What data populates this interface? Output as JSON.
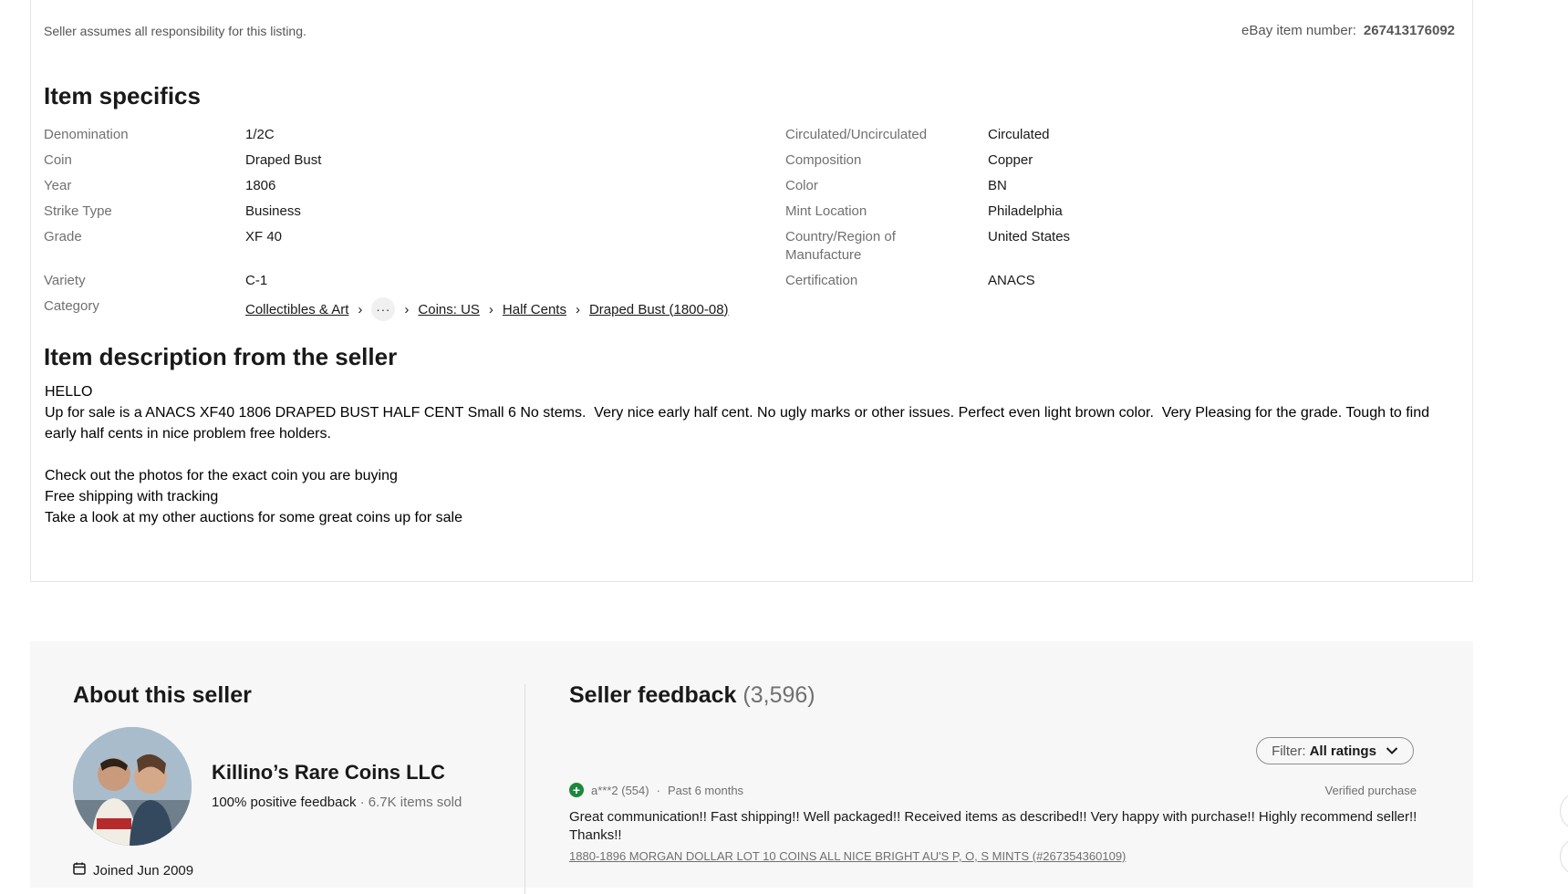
{
  "listing": {
    "disclaimer": "Seller assumes all responsibility for this listing.",
    "item_number_label": "eBay item number:",
    "item_number": "267413176092"
  },
  "specifics": {
    "title": "Item specifics",
    "left": [
      {
        "label": "Denomination",
        "value": "1/2C"
      },
      {
        "label": "Coin",
        "value": "Draped Bust"
      },
      {
        "label": "Year",
        "value": "1806"
      },
      {
        "label": "Strike Type",
        "value": "Business"
      },
      {
        "label": "Grade",
        "value": "XF 40"
      },
      {
        "label": "Variety",
        "value": "C-1"
      },
      {
        "label": "Category",
        "value": ""
      }
    ],
    "right": [
      {
        "label": "Circulated/Uncirculated",
        "value": "Circulated"
      },
      {
        "label": "Composition",
        "value": "Copper"
      },
      {
        "label": "Color",
        "value": "BN"
      },
      {
        "label": "Mint Location",
        "value": "Philadelphia"
      },
      {
        "label": "Country/Region of Manufacture",
        "value": "United States"
      },
      {
        "label": "Certification",
        "value": "ANACS"
      }
    ],
    "category_crumbs": [
      "Collectibles & Art",
      "Coins: US",
      "Half Cents",
      "Draped Bust (1800-08)"
    ],
    "more_label": "···"
  },
  "description": {
    "title": "Item description from the seller",
    "body": "HELLO\nUp for sale is a ANACS XF40 1806 DRAPED BUST HALF CENT Small 6 No stems.  Very nice early half cent. No ugly marks or other issues. Perfect even light brown color.  Very Pleasing for the grade. Tough to find early half cents in nice problem free holders.\n\nCheck out the photos for the exact coin you are buying\nFree shipping with tracking\nTake a look at my other auctions for some great coins up for sale"
  },
  "seller": {
    "about_title": "About this seller",
    "name": "Killino’s Rare Coins LLC",
    "positive": "100% positive feedback",
    "items_sold": "6.7K items sold",
    "joined": "Joined Jun 2009"
  },
  "feedback": {
    "title": "Seller feedback",
    "count": "(3,596)",
    "filter_label": "Filter:",
    "filter_value": "All ratings",
    "entries": [
      {
        "user": "a***2 (554)",
        "when": "Past 6 months",
        "verified": "Verified purchase",
        "text": "Great communication!! Fast shipping!! Well packaged!! Received items as described!! Very happy with purchase!! Highly recommend seller!! Thanks!!",
        "item": "1880-1896 MORGAN DOLLAR LOT 10 COINS ALL NICE BRIGHT AU'S P, O, S MINTS (#267354360109)"
      }
    ]
  },
  "colors": {
    "positive_green": "#1a8a3a",
    "panel_bg": "#f7f7f7"
  }
}
